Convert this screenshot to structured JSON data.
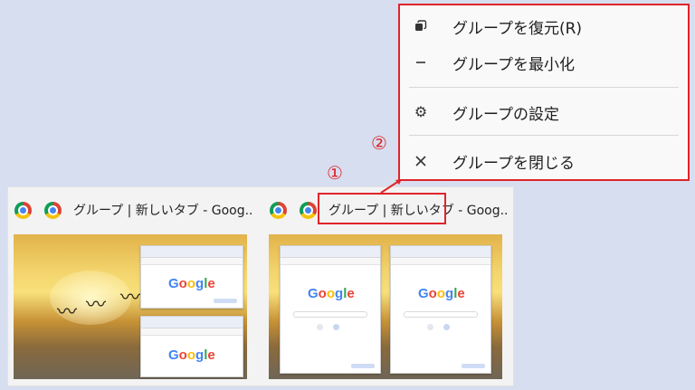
{
  "context_menu": {
    "items": [
      {
        "icon": "restore-icon",
        "label": "グループを復元(R)"
      },
      {
        "icon": "minimize-icon",
        "label": "グループを最小化"
      },
      {
        "icon": "gear-icon",
        "label": "グループの設定"
      },
      {
        "icon": "close-icon",
        "label": "グループを閉じる"
      }
    ]
  },
  "annotations": {
    "step1": "①",
    "step2": "②"
  },
  "previews": [
    {
      "title": "グループ | 新しいタブ - Goog..."
    },
    {
      "title": "グループ | 新しいタブ - Goog..."
    }
  ],
  "google_logo": "Google",
  "colors": {
    "annotation_red": "#e0242a",
    "background": "#d6deef"
  }
}
